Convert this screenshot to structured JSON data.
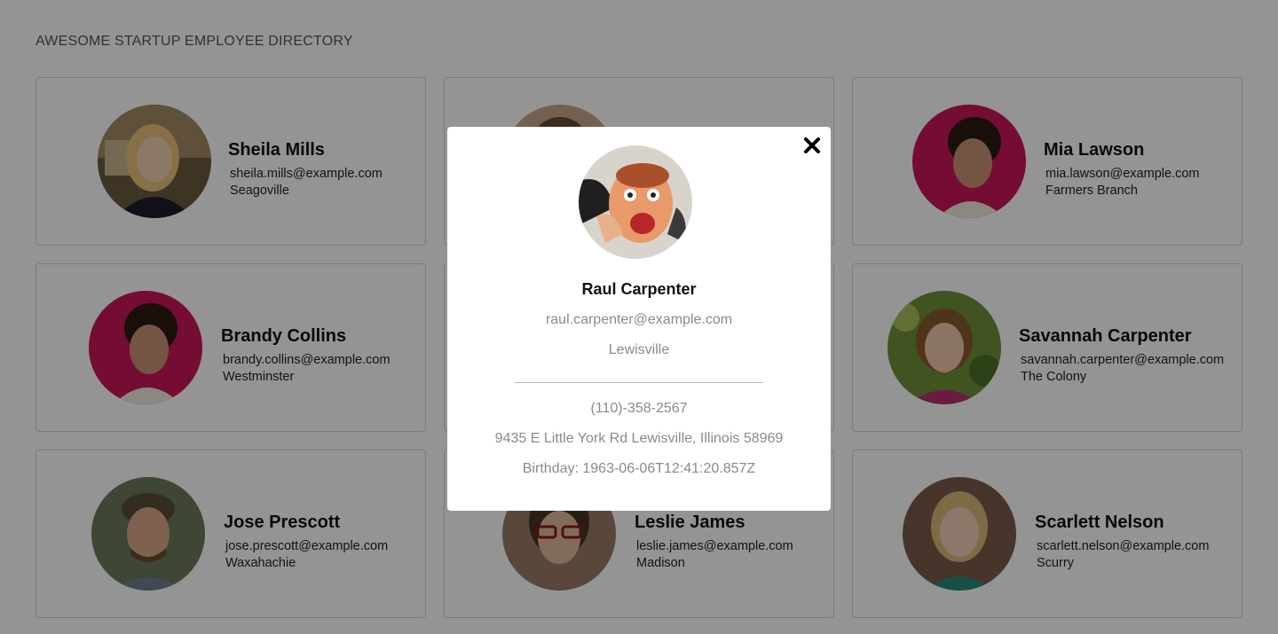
{
  "header": {
    "title": "AWESOME STARTUP EMPLOYEE DIRECTORY"
  },
  "employees": [
    {
      "name": "Sheila Mills",
      "email": "sheila.mills@example.com",
      "city": "Seagoville"
    },
    {
      "name": "",
      "email": "",
      "city": ""
    },
    {
      "name": "Mia Lawson",
      "email": "mia.lawson@example.com",
      "city": "Farmers Branch"
    },
    {
      "name": "Brandy Collins",
      "email": "brandy.collins@example.com",
      "city": "Westminster"
    },
    {
      "name": "",
      "email": "",
      "city": ""
    },
    {
      "name": "Savannah Carpenter",
      "email": "savannah.carpenter@example.com",
      "city": "The Colony"
    },
    {
      "name": "Jose Prescott",
      "email": "jose.prescott@example.com",
      "city": "Waxahachie"
    },
    {
      "name": "Leslie James",
      "email": "leslie.james@example.com",
      "city": "Madison"
    },
    {
      "name": "Scarlett Nelson",
      "email": "scarlett.nelson@example.com",
      "city": "Scurry"
    }
  ],
  "modal": {
    "name": "Raul Carpenter",
    "email": "raul.carpenter@example.com",
    "city": "Lewisville",
    "phone": "(110)-358-2567",
    "address": "9435 E Little York Rd Lewisville, Illinois 58969",
    "birthday": "Birthday: 1963-06-06T12:41:20.857Z",
    "close_icon": "close-icon"
  },
  "colors": {
    "overlay": "rgba(0,0,0,0.42)",
    "muted_text": "#8a8a8a",
    "card_border": "#d5d5d5"
  }
}
